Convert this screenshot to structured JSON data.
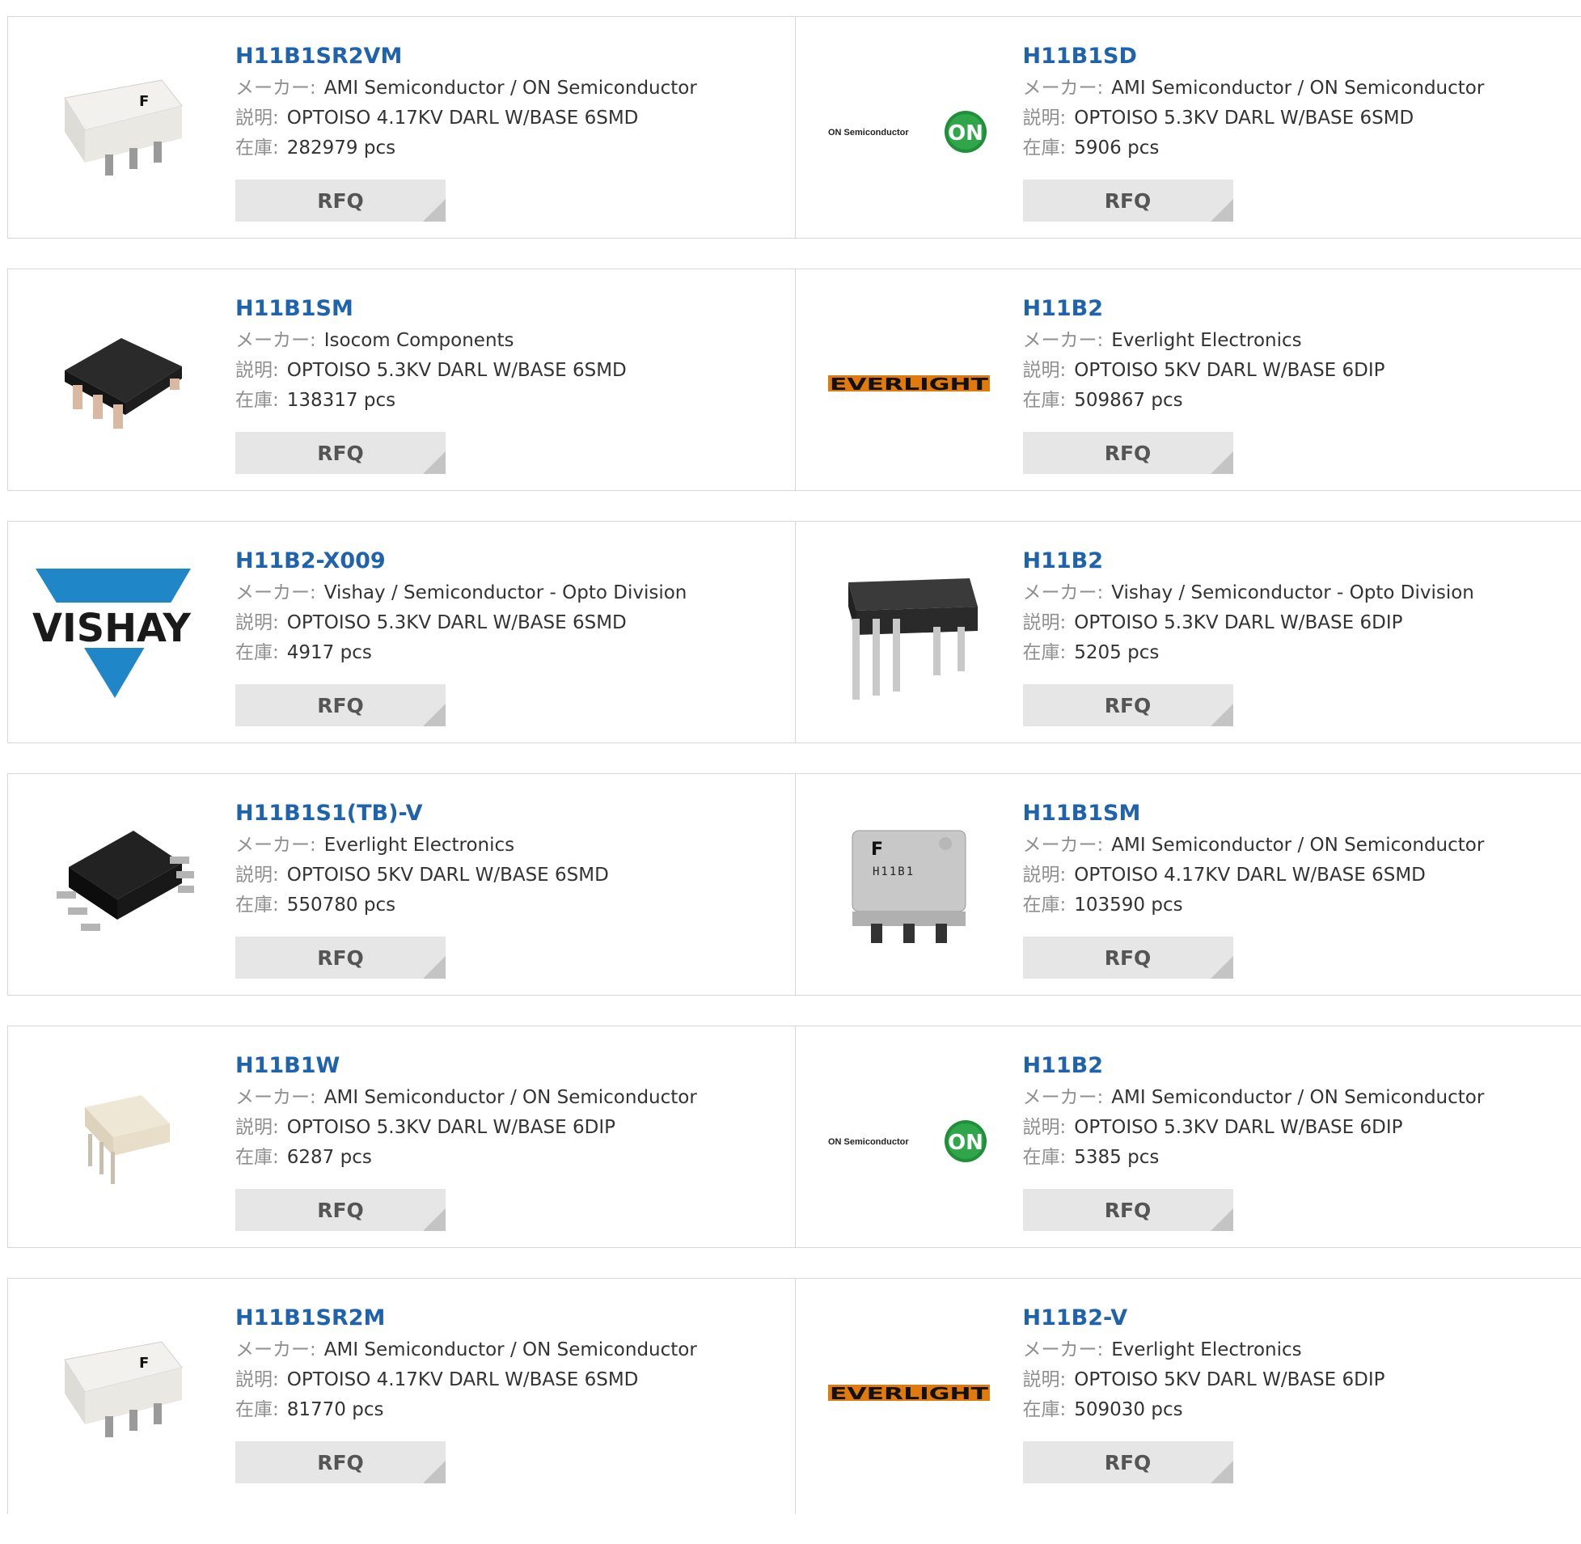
{
  "labels": {
    "maker": "メーカー:",
    "desc": "説明:",
    "stock": "在庫:",
    "rfq": "RFQ"
  },
  "logos": {
    "on_semi": "ON Semiconductor",
    "on_badge": "ON",
    "everlight": "EVERLIGHT",
    "vishay": "VISHAY"
  },
  "products": [
    {
      "part": "H11B1SR2VM",
      "maker": "AMI Semiconductor / ON Semiconductor",
      "desc": "OPTOISO 4.17KV DARL W/BASE 6SMD",
      "stock": "282979 pcs",
      "image": "white-smd-chip"
    },
    {
      "part": "H11B1SD",
      "maker": "AMI Semiconductor / ON Semiconductor",
      "desc": "OPTOISO 5.3KV DARL W/BASE 6SMD",
      "stock": "5906 pcs",
      "image": "on-semiconductor-logo"
    },
    {
      "part": "H11B1SM",
      "maker": "Isocom Components",
      "desc": "OPTOISO 5.3KV DARL W/BASE 6SMD",
      "stock": "138317 pcs",
      "image": "black-smd-chip-angled"
    },
    {
      "part": "H11B2",
      "maker": "Everlight Electronics",
      "desc": "OPTOISO 5KV DARL W/BASE 6DIP",
      "stock": "509867 pcs",
      "image": "everlight-logo"
    },
    {
      "part": "H11B2-X009",
      "maker": "Vishay / Semiconductor - Opto Division",
      "desc": "OPTOISO 5.3KV DARL W/BASE 6SMD",
      "stock": "4917 pcs",
      "image": "vishay-logo"
    },
    {
      "part": "H11B2",
      "maker": "Vishay / Semiconductor - Opto Division",
      "desc": "OPTOISO 5.3KV DARL W/BASE 6DIP",
      "stock": "5205 pcs",
      "image": "black-dip-chip"
    },
    {
      "part": "H11B1S1(TB)-V",
      "maker": "Everlight Electronics",
      "desc": "OPTOISO 5KV DARL W/BASE 6SMD",
      "stock": "550780 pcs",
      "image": "black-smd-chip"
    },
    {
      "part": "H11B1SM",
      "maker": "AMI Semiconductor / ON Semiconductor",
      "desc": "OPTOISO 4.17KV DARL W/BASE 6SMD",
      "stock": "103590 pcs",
      "image": "gray-chip-h11b1",
      "chip_text": "H11B1"
    },
    {
      "part": "H11B1W",
      "maker": "AMI Semiconductor / ON Semiconductor",
      "desc": "OPTOISO 5.3KV DARL W/BASE 6DIP",
      "stock": "6287 pcs",
      "image": "white-dip-chip"
    },
    {
      "part": "H11B2",
      "maker": "AMI Semiconductor / ON Semiconductor",
      "desc": "OPTOISO 5.3KV DARL W/BASE 6DIP",
      "stock": "5385 pcs",
      "image": "on-semiconductor-logo"
    },
    {
      "part": "H11B1SR2M",
      "maker": "AMI Semiconductor / ON Semiconductor",
      "desc": "OPTOISO 4.17KV DARL W/BASE 6SMD",
      "stock": "81770 pcs",
      "image": "white-smd-chip"
    },
    {
      "part": "H11B2-V",
      "maker": "Everlight Electronics",
      "desc": "OPTOISO 5KV DARL W/BASE 6DIP",
      "stock": "509030 pcs",
      "image": "everlight-logo"
    }
  ]
}
